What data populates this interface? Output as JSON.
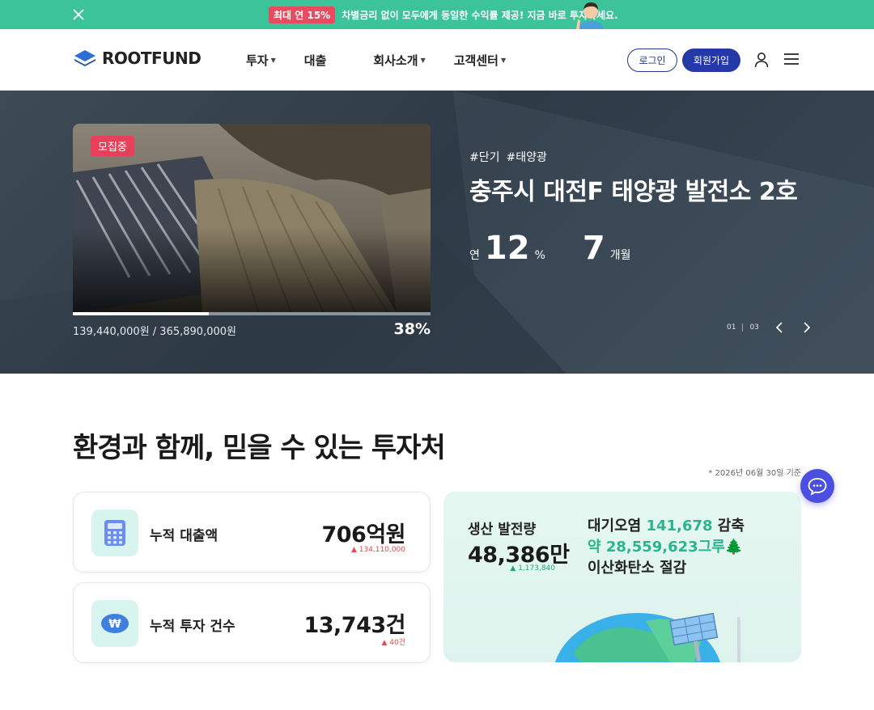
{
  "banner": {
    "pill": "최대 연 15%",
    "message": "차별금리 없이 모두에게 동일한 수익률 제공! 지금 바로 투자하세요.",
    "color": "#3cc39a"
  },
  "header": {
    "logo_text": "ROOTFUND",
    "nav": [
      {
        "label": "투자",
        "dropdown": true
      },
      {
        "label": "대출",
        "dropdown": false
      },
      {
        "label": "회사소개",
        "dropdown": true
      },
      {
        "label": "고객센터",
        "dropdown": true
      }
    ],
    "login_label": "로그인",
    "join_label": "회원가입",
    "accent": "#2438a8"
  },
  "hero": {
    "badge": "모집중",
    "tags": [
      "#단기",
      "#태양광"
    ],
    "title": "충주시 대전F 태양광 발전소 2호",
    "rate_prefix": "연",
    "rate_value": "12",
    "rate_unit": "%",
    "term_value": "7",
    "term_unit": "개월",
    "amounts": "139,440,000원 / 365,890,000원",
    "percent_text": "38%",
    "progress": 0.38,
    "pager_current": "01",
    "pager_total": "03"
  },
  "stats": {
    "title": "환경과 함께, 믿을 수 있는 투자처",
    "as_of": "* 2026년 06월 30일 기준",
    "loan": {
      "label": "누적 대출액",
      "value": "706억원",
      "delta": "▲ 134,110,000"
    },
    "count": {
      "label": "누적 투자 건수",
      "value": "13,743건",
      "delta": "▲ 40건"
    },
    "eco": {
      "gen_label": "생산 발전량",
      "gen_value": "48,386만",
      "gen_delta": "▲ 1,173,840",
      "air_line1_pre": "대기오염",
      "air_line1_hl": "141,678",
      "air_line1_post": "감축",
      "air_line2_hl": "약 28,559,623그루🌲",
      "air_line3": "이산화탄소 절감"
    }
  }
}
